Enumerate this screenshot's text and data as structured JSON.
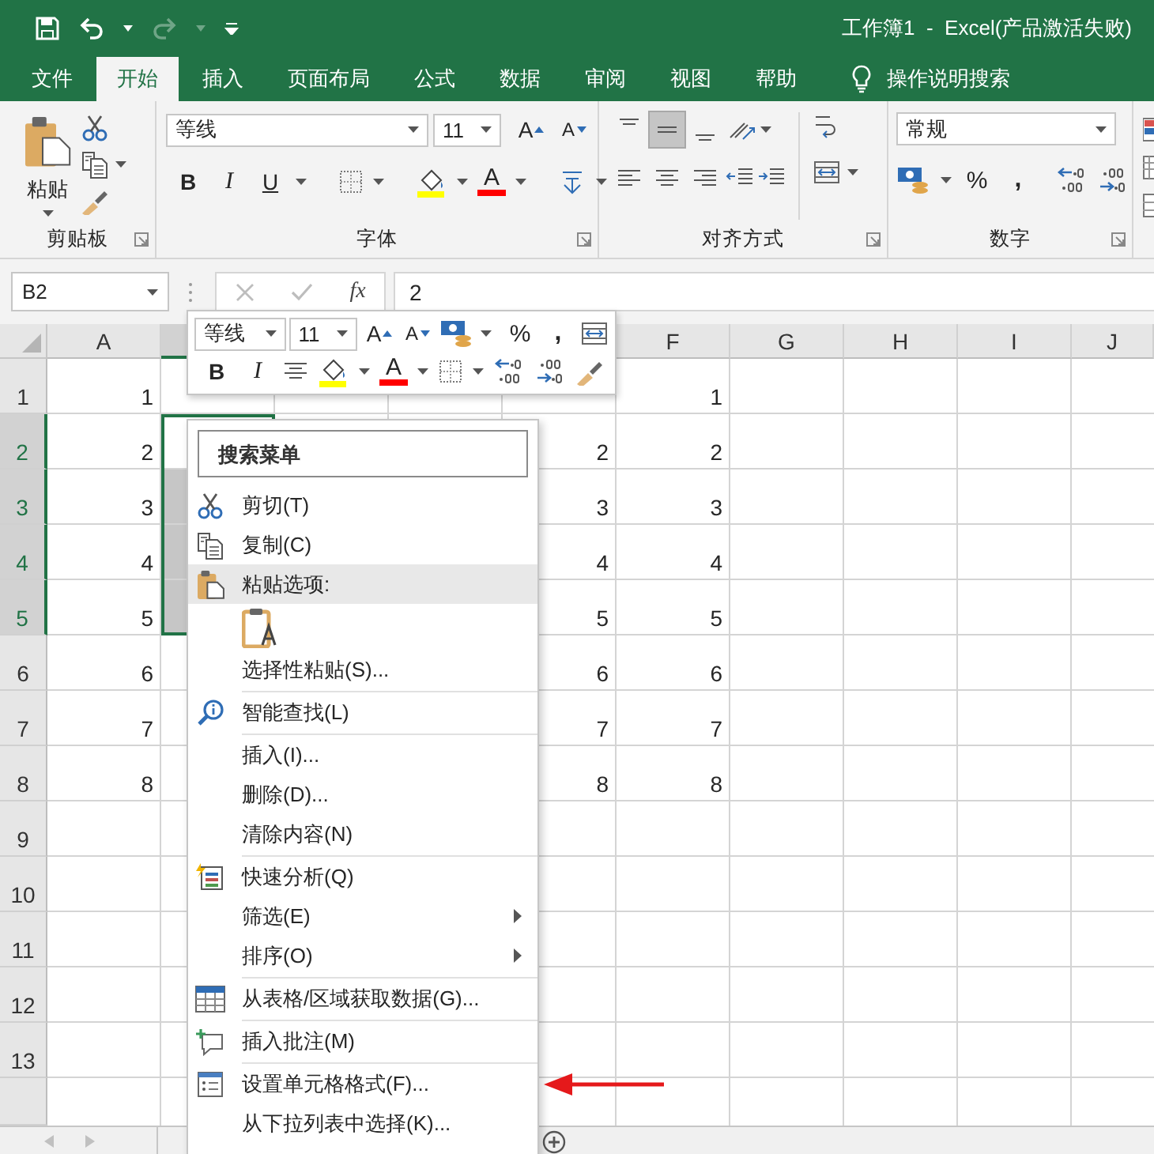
{
  "title_bar": {
    "quick_access": [
      {
        "kind": "save",
        "disabled": false
      },
      {
        "kind": "undo",
        "disabled": false
      },
      {
        "kind": "redo",
        "disabled": true
      },
      {
        "kind": "customize",
        "disabled": false
      }
    ],
    "title": "工作簿1  -  Excel(产品激活失败)"
  },
  "tabs": [
    {
      "label": "文件",
      "selected": false
    },
    {
      "label": "开始",
      "selected": true
    },
    {
      "label": "插入",
      "selected": false
    },
    {
      "label": "页面布局",
      "selected": false
    },
    {
      "label": "公式",
      "selected": false
    },
    {
      "label": "数据",
      "selected": false
    },
    {
      "label": "审阅",
      "selected": false
    },
    {
      "label": "视图",
      "selected": false
    },
    {
      "label": "帮助",
      "selected": false
    }
  ],
  "tell_me": {
    "label": "操作说明搜索"
  },
  "ribbon": {
    "clipboard": {
      "label": "剪贴板",
      "paste": "粘贴"
    },
    "font": {
      "label": "字体",
      "font_name": "等线",
      "font_size": "11",
      "grow": "A",
      "shrink": "A",
      "bold": "B",
      "italic": "I",
      "underline": "U",
      "font_color": "A"
    },
    "alignment": {
      "label": "对齐方式",
      "buttons": [
        {
          "kind": "top",
          "selected": false
        },
        {
          "kind": "middle",
          "selected": true
        },
        {
          "kind": "bottom",
          "selected": false
        },
        {
          "kind": "left",
          "selected": false
        },
        {
          "kind": "center",
          "selected": false
        },
        {
          "kind": "right",
          "selected": false
        }
      ]
    },
    "number": {
      "label": "数字",
      "format": "常规",
      "percent": "%",
      "comma": ","
    }
  },
  "formula_bar": {
    "name_box": "B2",
    "function_label": "fx",
    "value": "2"
  },
  "sheet": {
    "columns": [
      {
        "label": "A",
        "selected": false
      },
      {
        "selected": true
      },
      null,
      null,
      null,
      {
        "label": "F",
        "selected": false
      },
      {
        "label": "G",
        "selected": false
      },
      {
        "label": "H",
        "selected": false
      },
      {
        "label": "I",
        "selected": false
      },
      {
        "label": "J",
        "selected": false
      }
    ],
    "rows": [
      {
        "label": "1",
        "selected": false,
        "cells": [
          "1",
          null,
          null,
          null,
          null,
          "1",
          null,
          null,
          null,
          null
        ]
      },
      {
        "label": "2",
        "selected": true,
        "cells": [
          "2",
          null,
          null,
          null,
          "2",
          "2",
          null,
          null,
          null,
          null
        ]
      },
      {
        "label": "3",
        "selected": true,
        "cells": [
          "3",
          null,
          null,
          null,
          "3",
          "3",
          null,
          null,
          null,
          null
        ]
      },
      {
        "label": "4",
        "selected": true,
        "cells": [
          "4",
          null,
          null,
          null,
          "4",
          "4",
          null,
          null,
          null,
          null
        ]
      },
      {
        "label": "5",
        "selected": true,
        "cells": [
          "5",
          null,
          null,
          null,
          "5",
          "5",
          null,
          null,
          null,
          null
        ]
      },
      {
        "label": "6",
        "selected": false,
        "cells": [
          "6",
          null,
          null,
          null,
          "6",
          "6",
          null,
          null,
          null,
          null
        ]
      },
      {
        "label": "7",
        "selected": false,
        "cells": [
          "7",
          null,
          null,
          null,
          "7",
          "7",
          null,
          null,
          null,
          null
        ]
      },
      {
        "label": "8",
        "selected": false,
        "cells": [
          "8",
          null,
          null,
          null,
          "8",
          "8",
          null,
          null,
          null,
          null
        ]
      },
      {
        "label": "9",
        "selected": false,
        "cells": [
          null,
          null,
          null,
          null,
          null,
          null,
          null,
          null,
          null,
          null
        ]
      },
      {
        "label": "10",
        "selected": false,
        "cells": [
          null,
          null,
          null,
          null,
          null,
          null,
          null,
          null,
          null,
          null
        ]
      },
      {
        "label": "11",
        "selected": false,
        "cells": [
          null,
          null,
          null,
          null,
          null,
          null,
          null,
          null,
          null,
          null
        ]
      },
      {
        "label": "12",
        "selected": false,
        "cells": [
          null,
          null,
          null,
          null,
          null,
          null,
          null,
          null,
          null,
          null
        ]
      },
      {
        "label": "13",
        "selected": false,
        "cells": [
          null,
          null,
          null,
          null,
          null,
          null,
          null,
          null,
          null,
          null
        ]
      }
    ]
  },
  "mini_toolbar": {
    "font_name": "等线",
    "font_size": "11",
    "grow": "A",
    "shrink": "A",
    "percent": "%",
    "comma": ",",
    "bold": "B",
    "italic": "I",
    "font_color": "A"
  },
  "context_menu": {
    "search": {
      "placeholder": "搜索菜单"
    },
    "items": [
      {
        "kind": "cut",
        "label": "剪切(T)",
        "highlighted": false
      },
      {
        "kind": "copy",
        "label": "复制(C)",
        "highlighted": false
      },
      {
        "kind": "paste-header",
        "label": "粘贴选项:",
        "highlighted": true
      },
      {
        "kind": "paste-option"
      },
      {
        "kind": "plain",
        "label": "选择性粘贴(S)...",
        "highlighted": false
      },
      {
        "kind": "separator"
      },
      {
        "kind": "smart-lookup",
        "label": "智能查找(L)",
        "highlighted": false
      },
      {
        "kind": "separator"
      },
      {
        "kind": "plain",
        "label": "插入(I)...",
        "highlighted": false
      },
      {
        "kind": "plain",
        "label": "删除(D)...",
        "highlighted": false
      },
      {
        "kind": "plain",
        "label": "清除内容(N)",
        "highlighted": false
      },
      {
        "kind": "separator"
      },
      {
        "kind": "quick-analysis",
        "label": "快速分析(Q)",
        "highlighted": false
      },
      {
        "kind": "submenu",
        "label": "筛选(E)",
        "highlighted": false
      },
      {
        "kind": "submenu",
        "label": "排序(O)",
        "highlighted": false
      },
      {
        "kind": "separator"
      },
      {
        "kind": "get-data",
        "label": "从表格/区域获取数据(G)...",
        "highlighted": false
      },
      {
        "kind": "separator"
      },
      {
        "kind": "comment",
        "label": "插入批注(M)",
        "highlighted": false
      },
      {
        "kind": "separator"
      },
      {
        "kind": "format-cells",
        "label": "设置单元格格式(F)...",
        "highlighted": false
      },
      {
        "kind": "plain",
        "label": "从下拉列表中选择(K)...",
        "highlighted": false
      }
    ]
  }
}
